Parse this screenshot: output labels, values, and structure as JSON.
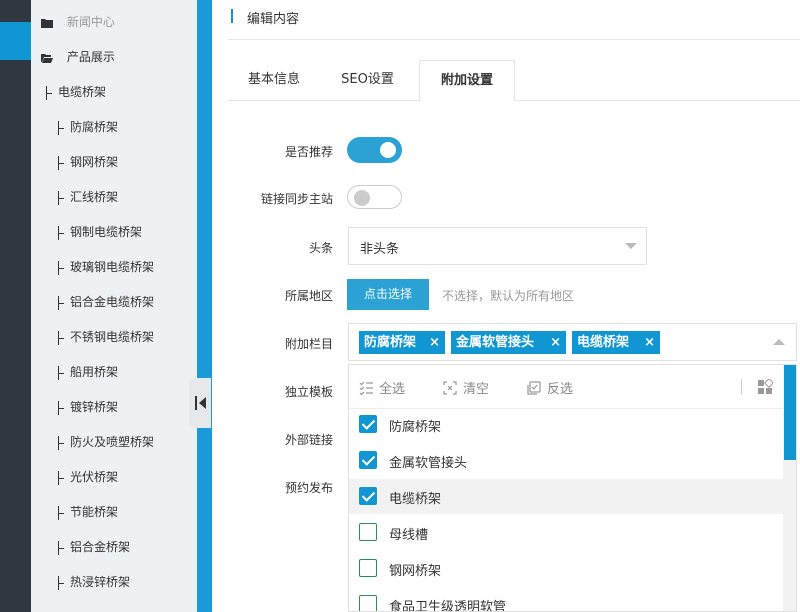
{
  "tree": {
    "roots": [
      {
        "label": "新闻中心",
        "icon": "folder-icon"
      },
      {
        "label": "产品展示",
        "icon": "folder-open-icon"
      }
    ],
    "group": "电缆桥架",
    "items": [
      "防腐桥架",
      "钢网桥架",
      "汇线桥架",
      "钢制电缆桥架",
      "玻璃钢电缆桥架",
      "铝合金电缆桥架",
      "不锈钢电缆桥架",
      "船用桥架",
      "镀锌桥架",
      "防火及喷塑桥架",
      "光伏桥架",
      "节能桥架",
      "铝合金桥架",
      "热浸锌桥架"
    ]
  },
  "header": {
    "title": "编辑内容"
  },
  "tabs": [
    {
      "label": "基本信息",
      "active": false
    },
    {
      "label": "SEO设置",
      "active": false
    },
    {
      "label": "附加设置",
      "active": true
    }
  ],
  "form": {
    "recommend_label": "是否推荐",
    "recommend_on": true,
    "sync_label": "链接同步主站",
    "sync_on": false,
    "headline_label": "头条",
    "headline_value": "非头条",
    "region_label": "所属地区",
    "region_button": "点击选择",
    "region_hint": "不选择，默认为所有地区",
    "column_label": "附加栏目",
    "template_label": "独立模板",
    "external_label": "外部链接",
    "schedule_label": "预约发布",
    "tags": [
      "防腐桥架",
      "金属软管接头",
      "电缆桥架"
    ]
  },
  "dropdown": {
    "select_all": "全选",
    "clear": "清空",
    "invert": "反选",
    "options": [
      {
        "label": "防腐桥架",
        "checked": true
      },
      {
        "label": "金属软管接头",
        "checked": true
      },
      {
        "label": "电缆桥架",
        "checked": true
      },
      {
        "label": "母线槽",
        "checked": false
      },
      {
        "label": "钢网桥架",
        "checked": false
      },
      {
        "label": "食品卫生级透明软管",
        "checked": false
      }
    ]
  },
  "colors": {
    "accent": "#0f96d3",
    "rail": "#2f3740",
    "sidebar": "#eef1f4"
  }
}
